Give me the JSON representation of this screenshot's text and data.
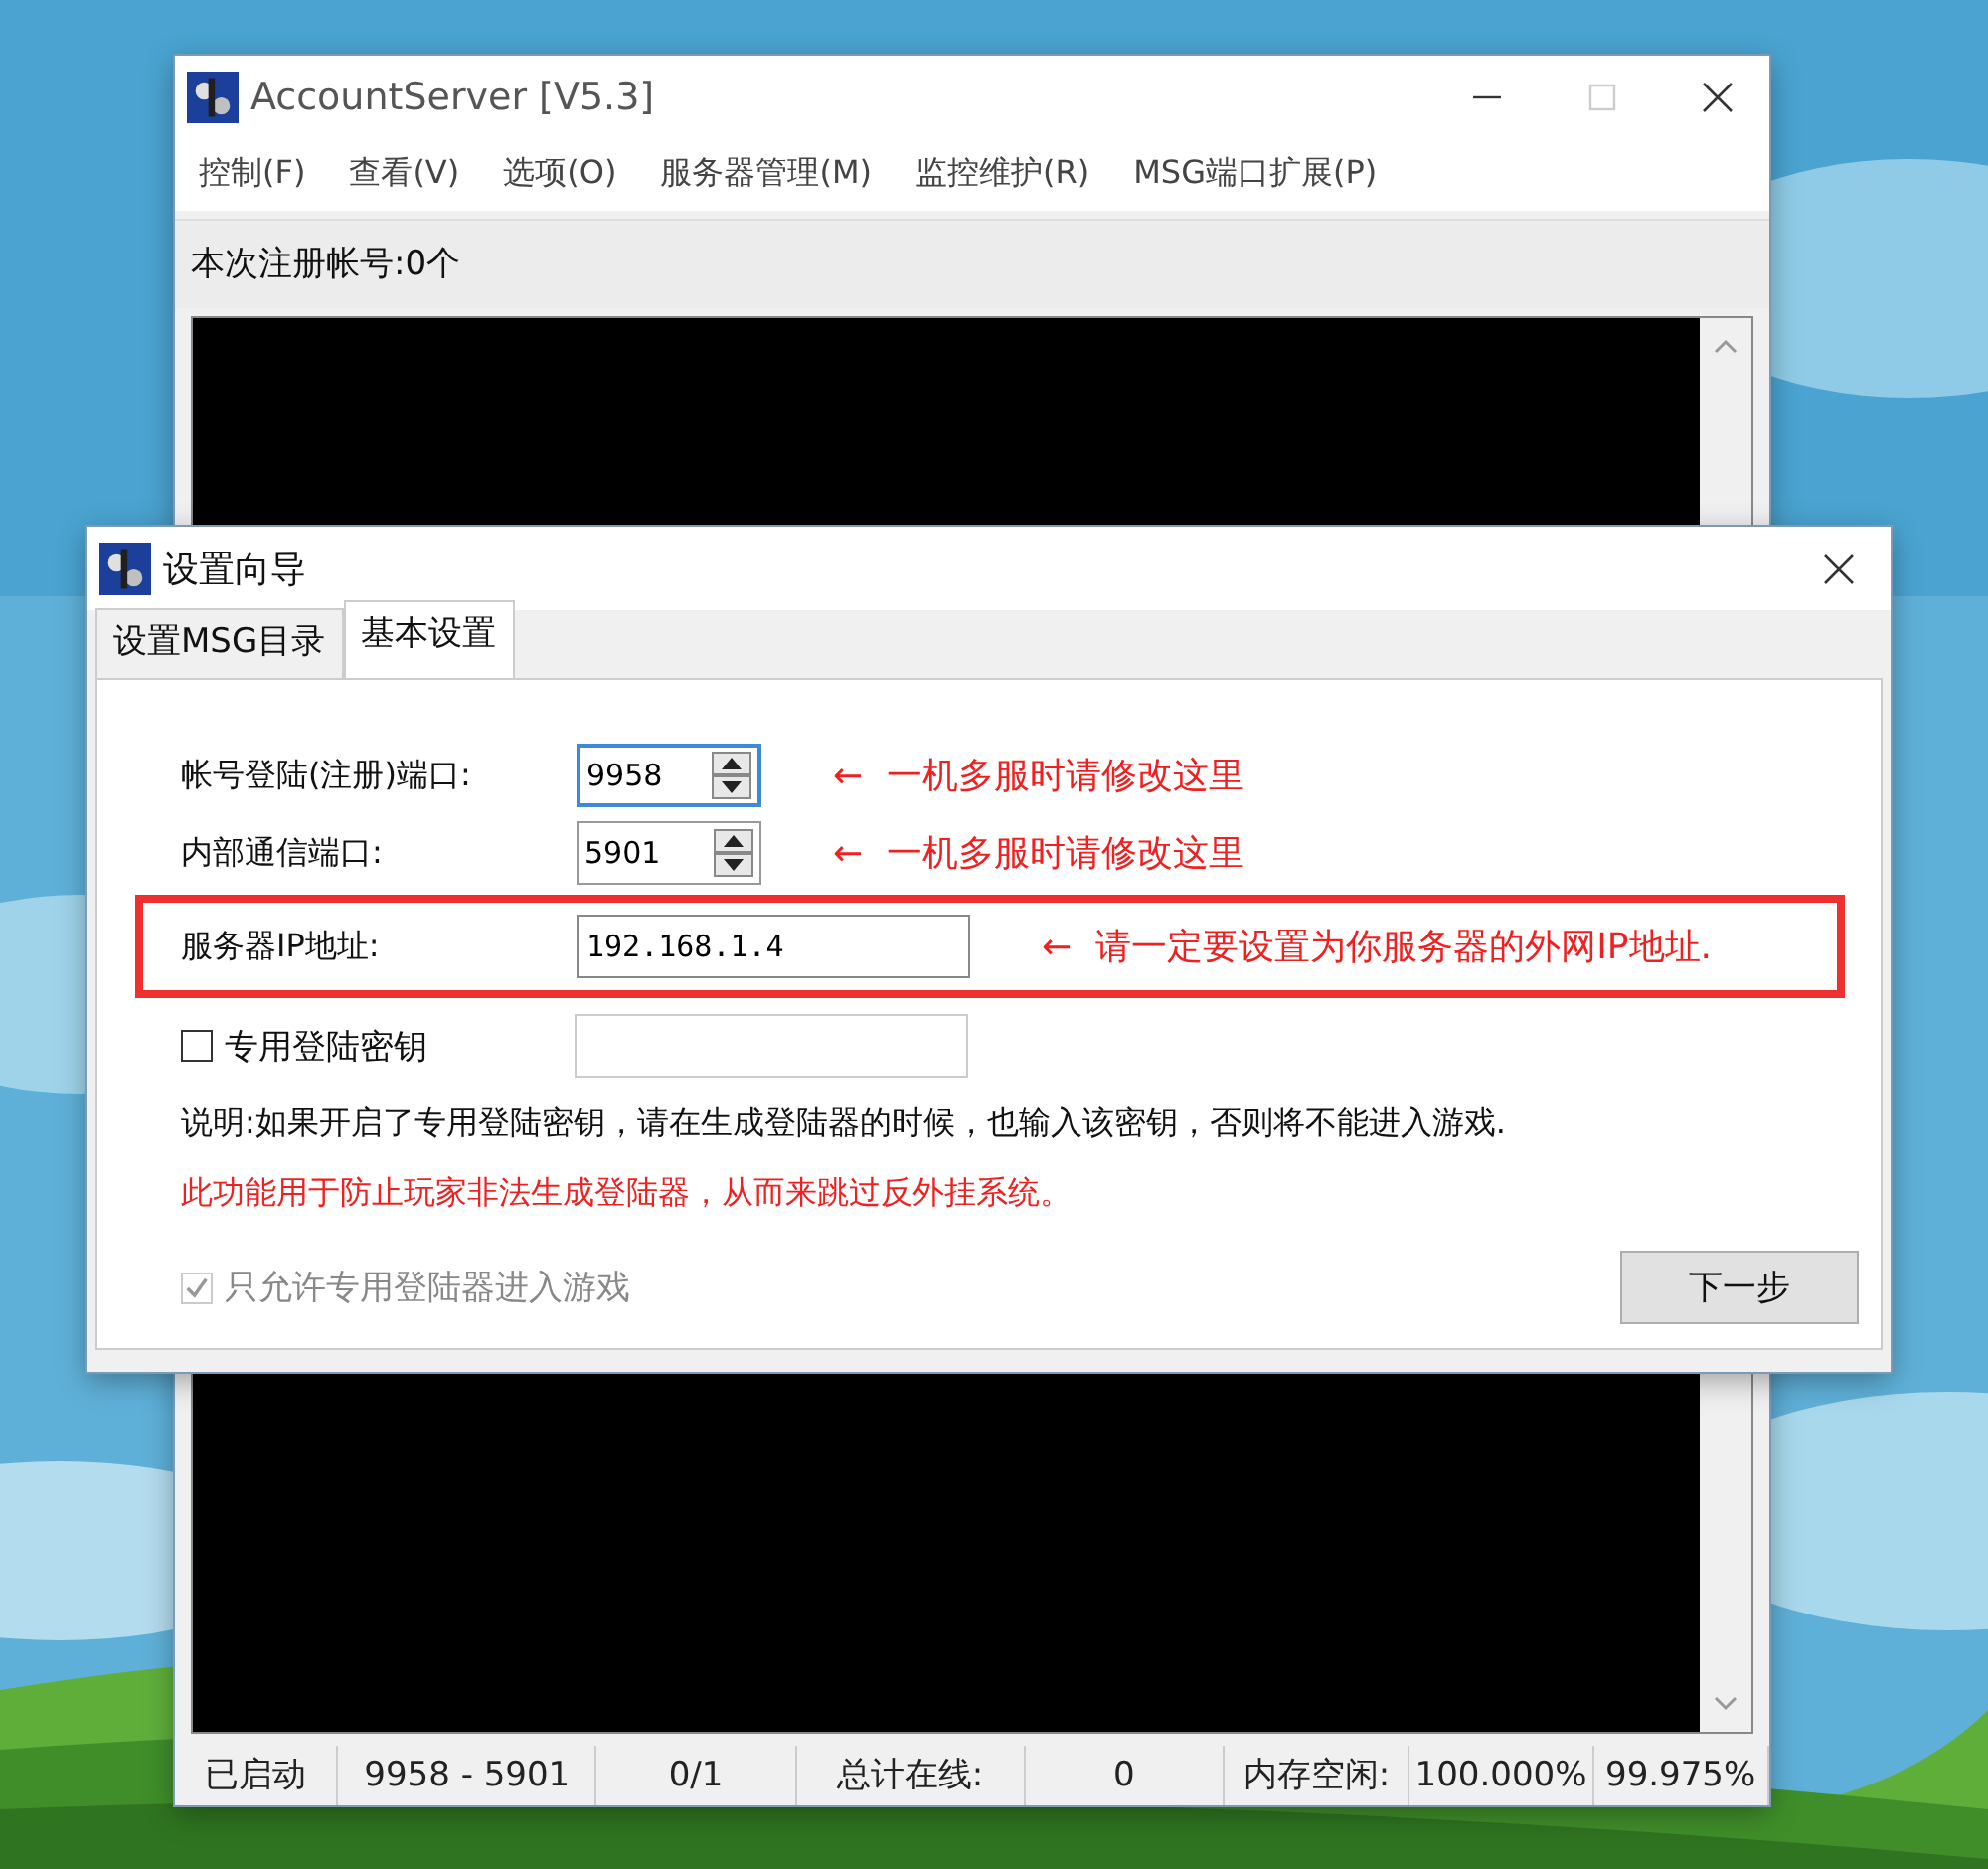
{
  "main_window": {
    "title": "AccountServer [V5.3]",
    "menu": [
      "控制(F)",
      "查看(V)",
      "选项(O)",
      "服务器管理(M)",
      "监控维护(R)",
      "MSG端口扩展(P)"
    ],
    "registered": "本次注册帐号:0个",
    "status_bar": [
      "已启动",
      "9958 - 5901",
      "0/1",
      "总计在线:",
      "0",
      "内存空闲:",
      "100.000%",
      "99.975%"
    ]
  },
  "dialog": {
    "title": "设置向导",
    "tabs": [
      {
        "label": "设置MSG目录",
        "selected": false
      },
      {
        "label": "基本设置",
        "selected": true
      }
    ],
    "fields": [
      {
        "kind": "spin",
        "label": "帐号登陆(注册)端口:",
        "value": "9958",
        "focused": true,
        "highlighted": false,
        "arrow": "←",
        "note": "一机多服时请修改这里"
      },
      {
        "kind": "spin",
        "label": "内部通信端口:",
        "value": "5901",
        "focused": false,
        "highlighted": false,
        "arrow": "←",
        "note": "一机多服时请修改这里"
      },
      {
        "kind": "text",
        "label": "服务器IP地址:",
        "value": "192.168.1.4",
        "focused": false,
        "highlighted": true,
        "arrow": "←",
        "note": "请一定要设置为你服务器的外网IP地址."
      },
      {
        "kind": "check",
        "label": "专用登陆密钥",
        "checked": false
      }
    ],
    "description": "说明:如果开启了专用登陆密钥，请在生成登陆器的时候，也输入该密钥，否则将不能进入游戏.",
    "warning": "此功能用于防止玩家非法生成登陆器，从而来跳过反外挂系统。",
    "option": {
      "label": "只允许专用登陆器进入游戏",
      "checked": true,
      "disabled": true
    },
    "button": "下一步"
  }
}
